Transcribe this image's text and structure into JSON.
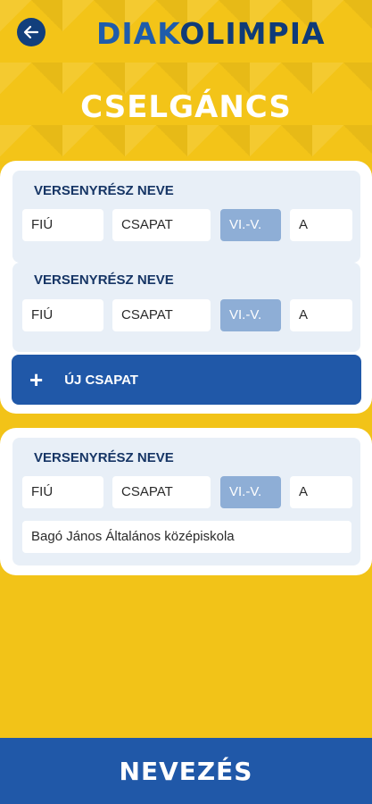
{
  "header": {
    "logo_part1": "DIAK",
    "logo_part2": "OLIMPIA",
    "title": "CSELGÁNCS"
  },
  "entries": [
    {
      "label": "VERSENYRÉSZ NEVE",
      "gender": "FIÚ",
      "type": "CSAPAT",
      "class": "VI.-V.",
      "letter": "A"
    },
    {
      "label": "VERSENYRÉSZ NEVE",
      "gender": "FIÚ",
      "type": "CSAPAT",
      "class": "VI.-V.",
      "letter": "A"
    }
  ],
  "add_team_label": "ÚJ CSAPAT",
  "add_team_icon": "+",
  "school_entry": {
    "label": "VERSENYRÉSZ NEVE",
    "gender": "FIÚ",
    "type": "CSAPAT",
    "class": "VI.-V.",
    "letter": "A",
    "school": "Bagó János Általános középiskola"
  },
  "footer_button": "NEVEZÉS",
  "colors": {
    "background": "#f2c318",
    "primary": "#2058a8",
    "navy": "#123f7c",
    "panel": "#e8eff7",
    "class_chip": "#8eaed6"
  }
}
